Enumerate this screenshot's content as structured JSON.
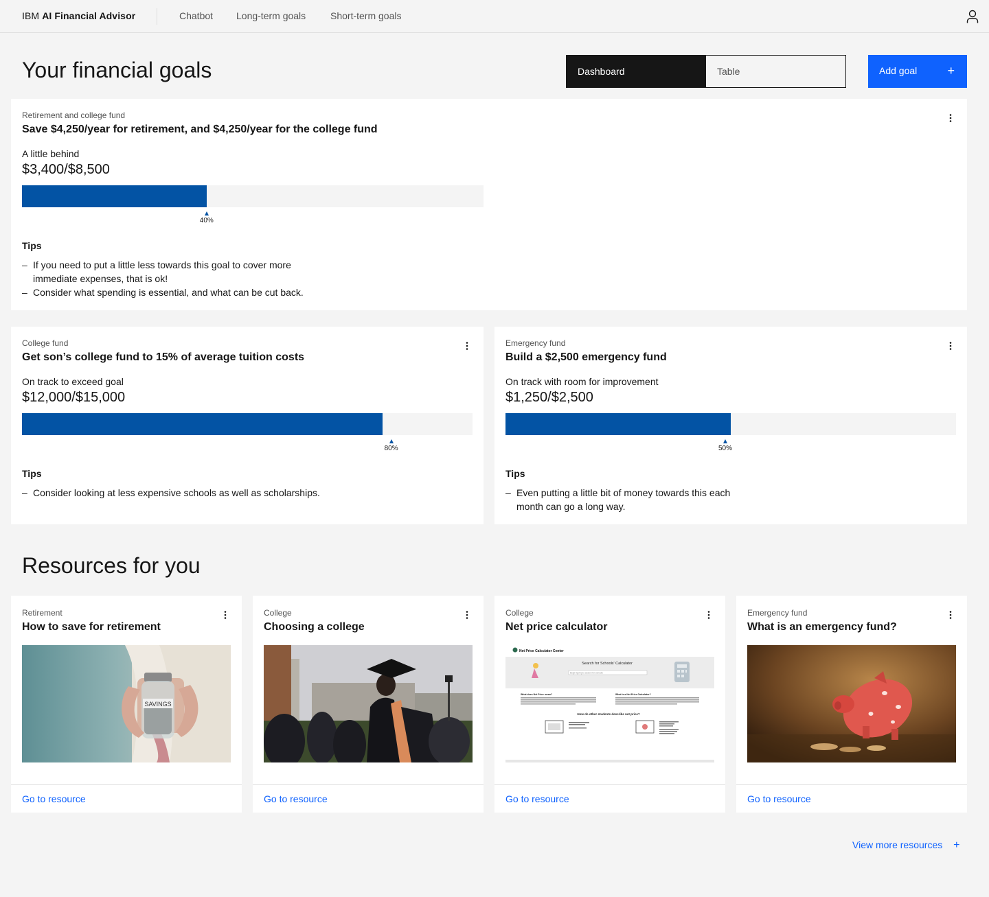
{
  "header": {
    "brand_prefix": "IBM",
    "brand_name": "AI Financial Advisor",
    "nav": [
      "Chatbot",
      "Long-term goals",
      "Short-term goals"
    ],
    "user_icon": "user-icon"
  },
  "page": {
    "title": "Your financial goals",
    "view_switch": {
      "active": "Dashboard",
      "inactive": "Table"
    },
    "add_goal_label": "Add goal",
    "add_goal_icon": "+"
  },
  "goals": [
    {
      "eyebrow": "Retirement and college fund",
      "title": "Save $4,250/year for retirement, and $4,250/year for the college fund",
      "status": "A little behind",
      "amount": "$3,400/$8,500",
      "progress": 40,
      "progress_label": "40%",
      "tips_title": "Tips",
      "tips": [
        "If you need to put a little less towards this goal to cover more immediate expenses, that is ok!",
        "Consider what spending is essential, and what can be cut back."
      ]
    },
    {
      "eyebrow": "College fund",
      "title": "Get son’s college fund to 15% of average tuition costs",
      "status": "On track to exceed goal",
      "amount": "$12,000/$15,000",
      "progress": 80,
      "progress_label": "80%",
      "tips_title": "Tips",
      "tips": [
        "Consider looking at less expensive schools as well as scholarships."
      ]
    },
    {
      "eyebrow": "Emergency fund",
      "title": "Build a $2,500 emergency fund",
      "status": "On track with room for improvement",
      "amount": "$1,250/$2,500",
      "progress": 50,
      "progress_label": "50%",
      "tips_title": "Tips",
      "tips": [
        "Even putting a little bit of money towards this each month can go a long way."
      ]
    }
  ],
  "resources": {
    "title": "Resources for you",
    "items": [
      {
        "eyebrow": "Retirement",
        "title": "How to save for retirement",
        "link": "Go to resource",
        "jar_label": "SAVINGS"
      },
      {
        "eyebrow": "College",
        "title": "Choosing a college",
        "link": "Go to resource"
      },
      {
        "eyebrow": "College",
        "title": "Net price calculator",
        "link": "Go to resource",
        "screenshot": {
          "site_name": "Net Price Calculator Center",
          "search_title": "Search for Schools' Calculator",
          "search_placeholder": "Begin typing to search for schools",
          "q1": "What does Net Price mean?",
          "q2": "What is a Net Price Calculator?",
          "q3": "How do other students describe net price?"
        }
      },
      {
        "eyebrow": "Emergency fund",
        "title": "What is an emergency fund?",
        "link": "Go to resource"
      }
    ],
    "view_more": "View more resources",
    "view_more_icon": "+"
  },
  "colors": {
    "primary": "#0f62fe",
    "progress": "#0353a4",
    "dark": "#161616",
    "background": "#f4f4f4"
  }
}
